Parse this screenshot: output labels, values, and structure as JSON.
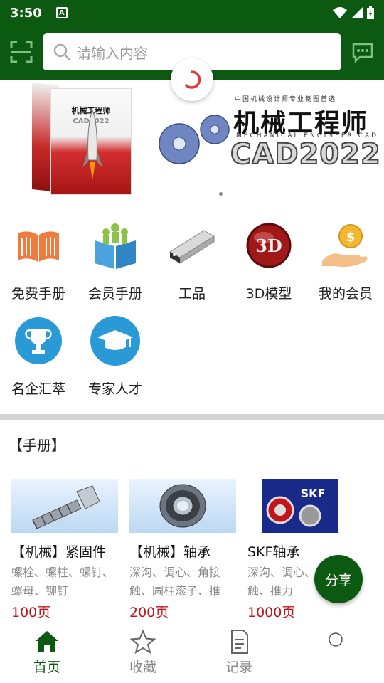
{
  "status_bar": {
    "time": "3:50",
    "notification": "A"
  },
  "header": {
    "search_placeholder": "请输入内容",
    "scan_icon": "scan-icon",
    "message_icon": "message-icon",
    "accent": "#0c5a12"
  },
  "banner": {
    "box_title": "机械工程师",
    "box_cad": "CAD2022",
    "tagline": "中国机械设计师专业制图首选",
    "title": "机械工程师",
    "subtitle": "MECHANICAL ENGINEER CAD",
    "cad": "CAD2022"
  },
  "grid": [
    {
      "label": "免费手册",
      "icon": "open-book-icon"
    },
    {
      "label": "会员手册",
      "icon": "member-book-icon"
    },
    {
      "label": "工品",
      "icon": "profile-bar-icon"
    },
    {
      "label": "3D模型",
      "icon": "3d-model-icon"
    },
    {
      "label": "我的会员",
      "icon": "coin-hand-icon"
    },
    {
      "label": "名企汇萃",
      "icon": "trophy-icon"
    },
    {
      "label": "专家人才",
      "icon": "graduation-cap-icon"
    }
  ],
  "section": {
    "title": "【手册】"
  },
  "cards": [
    {
      "title": "【机械】紧固件",
      "desc": "螺栓、螺柱、螺钉、螺母、铆钉",
      "pages": "100页"
    },
    {
      "title": "【机械】轴承",
      "desc": "深沟、调心、角接触、圆柱滚子、推",
      "pages": "200页"
    },
    {
      "title": "SKF轴承",
      "desc": "深沟、调心、角接触、推力",
      "pages": "1000页"
    }
  ],
  "share": {
    "label": "分享"
  },
  "bottom_nav": [
    {
      "label": "首页",
      "icon": "home-icon",
      "active": true
    },
    {
      "label": "收藏",
      "icon": "star-icon",
      "active": false
    },
    {
      "label": "记录",
      "icon": "document-icon",
      "active": false
    },
    {
      "label": "",
      "icon": "circle-icon",
      "active": false
    }
  ],
  "colors": {
    "primary_green": "#0c5a12",
    "price_red": "#c0151a",
    "spinner_red": "#e53935"
  }
}
